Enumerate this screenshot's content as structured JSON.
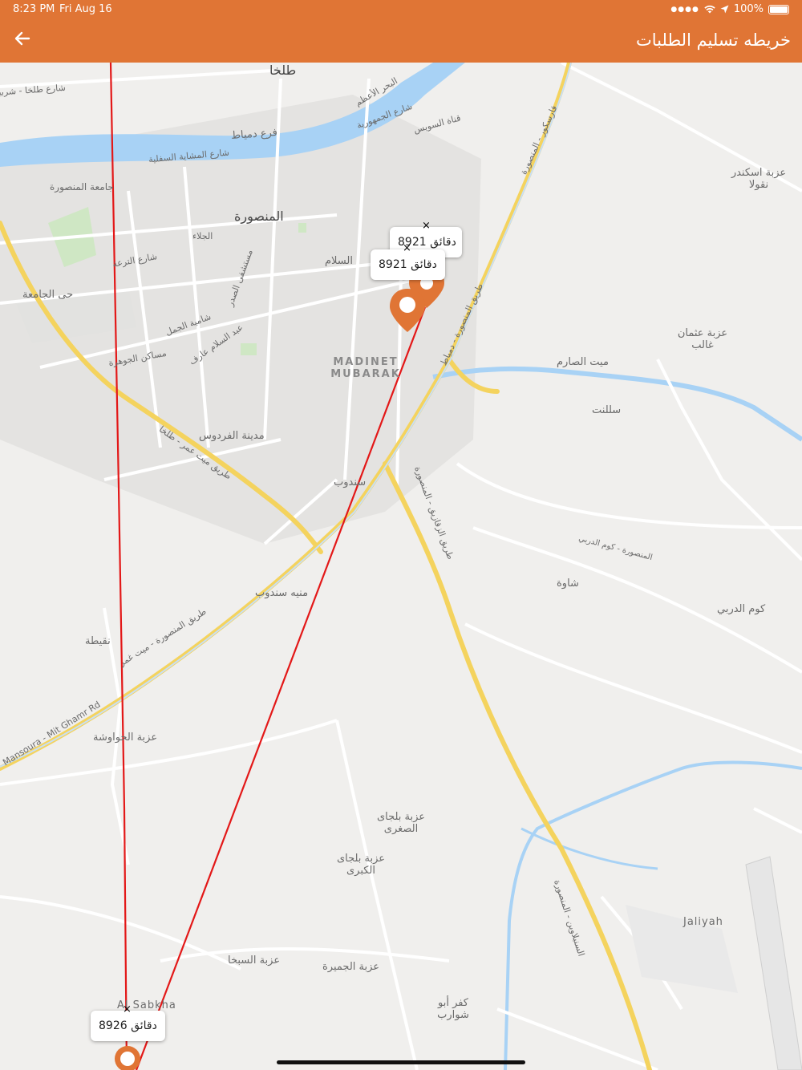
{
  "status_bar": {
    "time": "8:23 PM",
    "date": "Fri Aug 16",
    "battery": "100%"
  },
  "header": {
    "title": "خريطه تسليم الطلبات",
    "back_icon": "arrow-left-icon"
  },
  "colors": {
    "header": "#e07535",
    "route": "#e31818",
    "marker": "#e07535"
  },
  "map": {
    "labels": [
      "طلخا",
      "شارع طلخا - شربين",
      "فرع دمياط",
      "البحر الأعظم",
      "شارع الجمهورية",
      "قناة السويس",
      "شارع المشاية السفلية",
      "جامعة المنصورة",
      "المنصورة",
      "حى الجامعة",
      "الجلاء",
      "شارع الترعة",
      "شامية الجمل",
      "مساكن الجوهرة",
      "مستشفى الصدر",
      "عبد السلام عارف",
      "السلام",
      "MADINET MUBARAK",
      "مدينة الفردوس",
      "طريق ميت عمر - طلخا",
      "سندوب",
      "منيه سندوب",
      "نقيطة",
      "عزبة الحواوشة",
      "Mansoura - Mit Ghamr Rd",
      "طريق المنصورة - ميت غمر",
      "عزبة اسكندر نقولا",
      "عزبة عثمان غالب",
      "ميت الصارم",
      "سللنت",
      "طريق المنصورة - دمياط",
      "فارسكور - المنصورة",
      "المنصورة - كوم الدربي",
      "شاوة",
      "كوم الدربي",
      "طريق الزقازيق - المنصورة",
      "عزبة بلجاى الصغرى",
      "عزبة بلجاى الكبرى",
      "عزبة السبخا",
      "عزبة الجميرة",
      "كفر أبو شوارب",
      "Jaliyah",
      "السنبلاوين - المنصورة",
      "Al Sabkha"
    ],
    "callouts": [
      {
        "text": "8921 دقائق",
        "close": "×"
      },
      {
        "text": "8921 دقائق",
        "close": "×"
      },
      {
        "text": "8926 دقائق",
        "close": "×"
      }
    ],
    "markers": [
      "map-pin-icon",
      "map-pin-icon",
      "map-pin-icon"
    ]
  }
}
